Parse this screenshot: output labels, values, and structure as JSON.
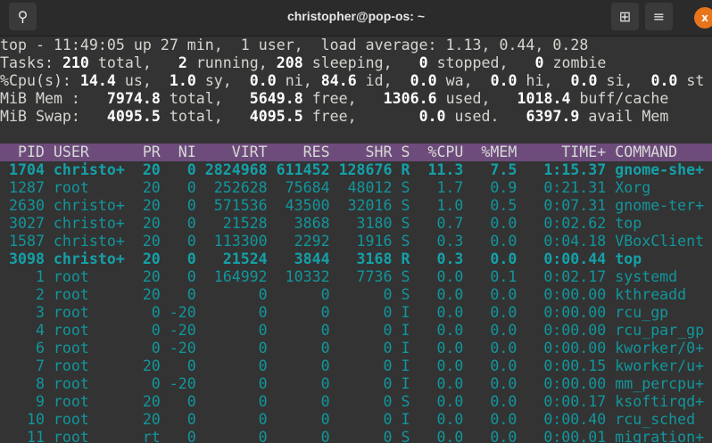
{
  "window": {
    "title": "christopher@pop-os: ~",
    "close_label": "x"
  },
  "summary": [
    [
      [
        "top - 11:49:05 up 27 min,  1 user,  load average: 1.13, 0.44, 0.28",
        0
      ]
    ],
    [
      [
        "Tasks: ",
        0
      ],
      [
        "210",
        1
      ],
      [
        " total,   ",
        0
      ],
      [
        "2",
        1
      ],
      [
        " running, ",
        0
      ],
      [
        "208",
        1
      ],
      [
        " sleeping,   ",
        0
      ],
      [
        "0",
        1
      ],
      [
        " stopped,   ",
        0
      ],
      [
        "0",
        1
      ],
      [
        " zombie",
        0
      ]
    ],
    [
      [
        "%Cpu(s): ",
        0
      ],
      [
        "14.4",
        1
      ],
      [
        " us,  ",
        0
      ],
      [
        "1.0",
        1
      ],
      [
        " sy,  ",
        0
      ],
      [
        "0.0",
        1
      ],
      [
        " ni, ",
        0
      ],
      [
        "84.6",
        1
      ],
      [
        " id,  ",
        0
      ],
      [
        "0.0",
        1
      ],
      [
        " wa,  ",
        0
      ],
      [
        "0.0",
        1
      ],
      [
        " hi,  ",
        0
      ],
      [
        "0.0",
        1
      ],
      [
        " si,  ",
        0
      ],
      [
        "0.0",
        1
      ],
      [
        " st",
        0
      ]
    ],
    [
      [
        "MiB Mem :   ",
        0
      ],
      [
        "7974.8",
        1
      ],
      [
        " total,   ",
        0
      ],
      [
        "5649.8",
        1
      ],
      [
        " free,   ",
        0
      ],
      [
        "1306.6",
        1
      ],
      [
        " used,   ",
        0
      ],
      [
        "1018.4",
        1
      ],
      [
        " buff/cache",
        0
      ]
    ],
    [
      [
        "MiB Swap:   ",
        0
      ],
      [
        "4095.5",
        1
      ],
      [
        " total,   ",
        0
      ],
      [
        "4095.5",
        1
      ],
      [
        " free,       ",
        0
      ],
      [
        "0.0",
        1
      ],
      [
        " used.   ",
        0
      ],
      [
        "6397.9",
        1
      ],
      [
        " avail Mem",
        0
      ]
    ]
  ],
  "columns": [
    "PID",
    "USER",
    "PR",
    "NI",
    "VIRT",
    "RES",
    "SHR",
    "S",
    "%CPU",
    "%MEM",
    "TIME+",
    "COMMAND"
  ],
  "processes": [
    {
      "bold": true,
      "cells": [
        "1704",
        "christo+",
        "20",
        "0",
        "2824968",
        "611452",
        "128676",
        "R",
        "11.3",
        "7.5",
        "1:15.37",
        "gnome-she+"
      ]
    },
    {
      "bold": false,
      "cells": [
        "1287",
        "root",
        "20",
        "0",
        "252628",
        "75684",
        "48012",
        "S",
        "1.7",
        "0.9",
        "0:21.31",
        "Xorg"
      ]
    },
    {
      "bold": false,
      "cells": [
        "2630",
        "christo+",
        "20",
        "0",
        "571536",
        "43500",
        "32016",
        "S",
        "1.0",
        "0.5",
        "0:07.31",
        "gnome-ter+"
      ]
    },
    {
      "bold": false,
      "cells": [
        "3027",
        "christo+",
        "20",
        "0",
        "21528",
        "3868",
        "3180",
        "S",
        "0.7",
        "0.0",
        "0:02.62",
        "top"
      ]
    },
    {
      "bold": false,
      "cells": [
        "1587",
        "christo+",
        "20",
        "0",
        "113300",
        "2292",
        "1916",
        "S",
        "0.3",
        "0.0",
        "0:04.18",
        "VBoxClient"
      ]
    },
    {
      "bold": true,
      "cells": [
        "3098",
        "christo+",
        "20",
        "0",
        "21524",
        "3844",
        "3168",
        "R",
        "0.3",
        "0.0",
        "0:00.44",
        "top"
      ]
    },
    {
      "bold": false,
      "cells": [
        "1",
        "root",
        "20",
        "0",
        "164992",
        "10332",
        "7736",
        "S",
        "0.0",
        "0.1",
        "0:02.17",
        "systemd"
      ]
    },
    {
      "bold": false,
      "cells": [
        "2",
        "root",
        "20",
        "0",
        "0",
        "0",
        "0",
        "S",
        "0.0",
        "0.0",
        "0:00.00",
        "kthreadd"
      ]
    },
    {
      "bold": false,
      "cells": [
        "3",
        "root",
        "0",
        "-20",
        "0",
        "0",
        "0",
        "I",
        "0.0",
        "0.0",
        "0:00.00",
        "rcu_gp"
      ]
    },
    {
      "bold": false,
      "cells": [
        "4",
        "root",
        "0",
        "-20",
        "0",
        "0",
        "0",
        "I",
        "0.0",
        "0.0",
        "0:00.00",
        "rcu_par_gp"
      ]
    },
    {
      "bold": false,
      "cells": [
        "6",
        "root",
        "0",
        "-20",
        "0",
        "0",
        "0",
        "I",
        "0.0",
        "0.0",
        "0:00.00",
        "kworker/0+"
      ]
    },
    {
      "bold": false,
      "cells": [
        "7",
        "root",
        "20",
        "0",
        "0",
        "0",
        "0",
        "I",
        "0.0",
        "0.0",
        "0:00.15",
        "kworker/u+"
      ]
    },
    {
      "bold": false,
      "cells": [
        "8",
        "root",
        "0",
        "-20",
        "0",
        "0",
        "0",
        "I",
        "0.0",
        "0.0",
        "0:00.00",
        "mm_percpu+"
      ]
    },
    {
      "bold": false,
      "cells": [
        "9",
        "root",
        "20",
        "0",
        "0",
        "0",
        "0",
        "S",
        "0.0",
        "0.0",
        "0:00.17",
        "ksoftirqd+"
      ]
    },
    {
      "bold": false,
      "cells": [
        "10",
        "root",
        "20",
        "0",
        "0",
        "0",
        "0",
        "I",
        "0.0",
        "0.0",
        "0:00.40",
        "rcu_sched"
      ]
    },
    {
      "bold": false,
      "cells": [
        "11",
        "root",
        "rt",
        "0",
        "0",
        "0",
        "0",
        "S",
        "0.0",
        "0.0",
        "0:00.01",
        "migration+"
      ]
    }
  ]
}
